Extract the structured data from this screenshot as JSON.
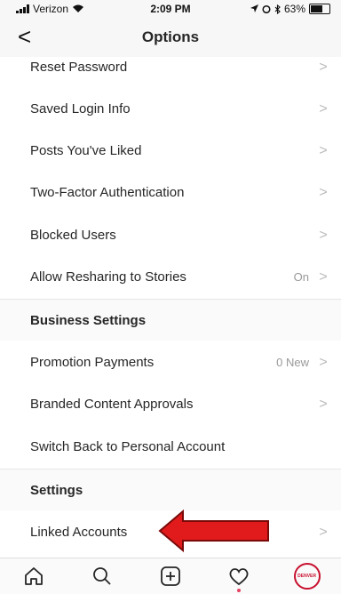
{
  "status": {
    "carrier": "Verizon",
    "time": "2:09 PM",
    "battery": "63%"
  },
  "nav": {
    "back_symbol": "<",
    "title": "Options"
  },
  "items": [
    {
      "label": "Reset Password",
      "value": "",
      "chevron": ">"
    },
    {
      "label": "Saved Login Info",
      "value": "",
      "chevron": ">"
    },
    {
      "label": "Posts You've Liked",
      "value": "",
      "chevron": ">"
    },
    {
      "label": "Two-Factor Authentication",
      "value": "",
      "chevron": ">"
    },
    {
      "label": "Blocked Users",
      "value": "",
      "chevron": ">"
    },
    {
      "label": "Allow Resharing to Stories",
      "value": "On",
      "chevron": ">"
    },
    {
      "label": "Business Settings",
      "header": true
    },
    {
      "label": "Promotion Payments",
      "value": "0 New",
      "chevron": ">"
    },
    {
      "label": "Branded Content Approvals",
      "value": "",
      "chevron": ">"
    },
    {
      "label": "Switch Back to Personal Account",
      "value": "",
      "chevron": ""
    },
    {
      "label": "Settings",
      "header": true
    },
    {
      "label": "Linked Accounts",
      "value": "",
      "chevron": ">"
    }
  ],
  "avatar_text": "DENVER",
  "colors": {
    "arrow": "#e11b1b",
    "accent": "#c8102e"
  },
  "tabs": [
    "home-icon",
    "search-icon",
    "add-post-icon",
    "activity-heart-icon",
    "profile-avatar"
  ]
}
